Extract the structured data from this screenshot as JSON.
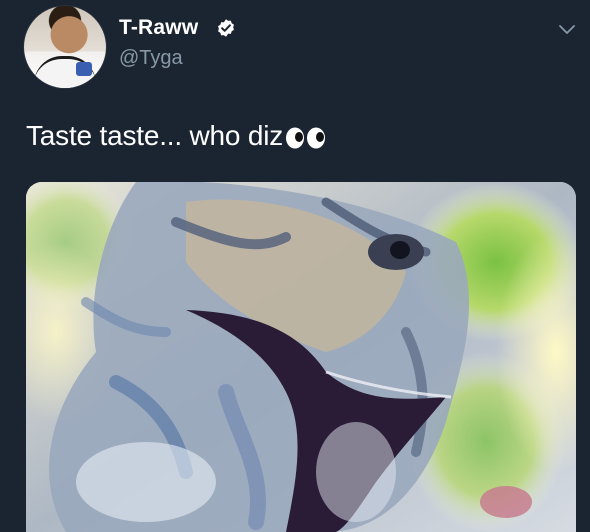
{
  "tweet": {
    "display_name": "T-Raww",
    "handle": "@Tyga",
    "text": "Taste taste... who diz",
    "emoji": "eyes-emoji"
  },
  "icons": {
    "verified": "verified-badge-icon",
    "caret": "chevron-down-icon"
  },
  "colors": {
    "background": "#1b2532",
    "primary_text": "#ffffff",
    "secondary_text": "#8899a6"
  }
}
